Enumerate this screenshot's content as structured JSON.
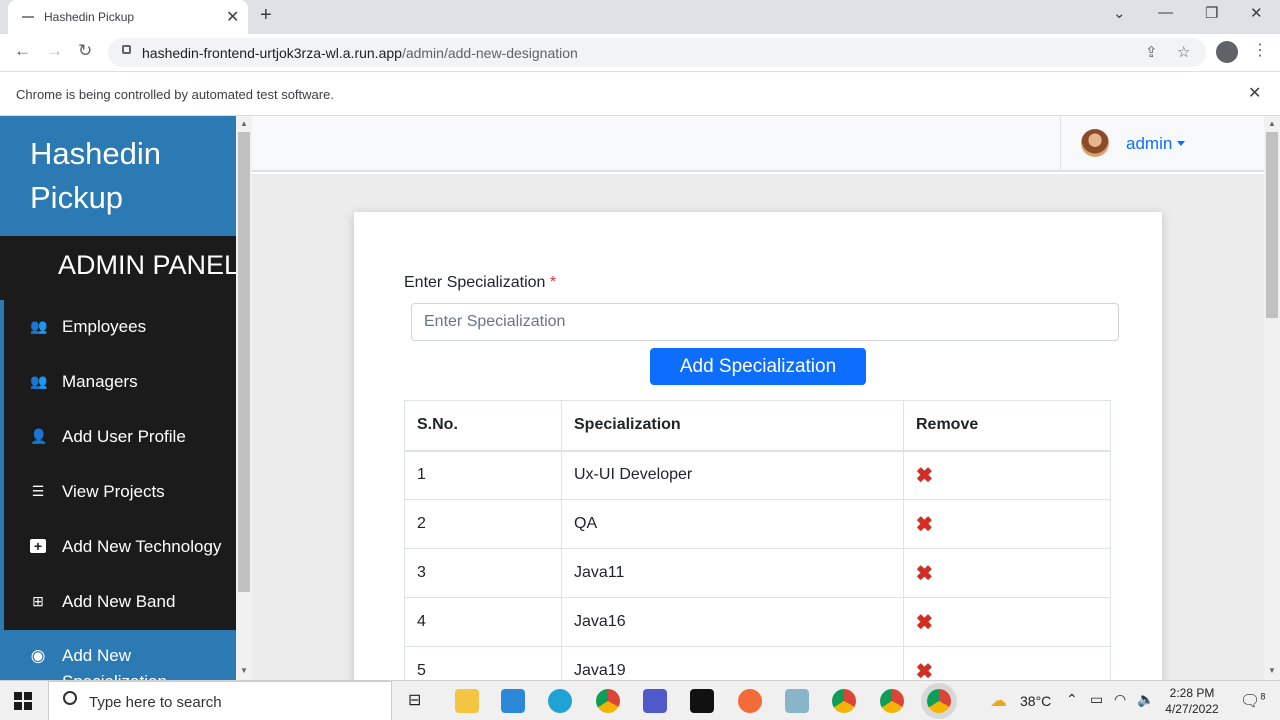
{
  "browser": {
    "tab_title": "Hashedin Pickup",
    "url_host": "hashedin-frontend-urtjok3rza-wl.a.run.app",
    "url_path": "/admin/add-new-designation",
    "infobar_text": "Chrome is being controlled by automated test software."
  },
  "sidebar": {
    "brand": "Hashedin Pickup",
    "panel_title": "ADMIN PANEL",
    "items": [
      {
        "label": "Employees",
        "icon": "users-icon"
      },
      {
        "label": "Managers",
        "icon": "users-icon"
      },
      {
        "label": "Add User Profile",
        "icon": "user-plus-icon"
      },
      {
        "label": "View Projects",
        "icon": "list-icon"
      },
      {
        "label": "Add New Technology",
        "icon": "plus-square-icon"
      },
      {
        "label": "Add New Band",
        "icon": "plus-square-outline-icon"
      },
      {
        "label": "Add New Specialization",
        "icon": "user-circle-icon"
      }
    ],
    "active_color": "#2c7ab3"
  },
  "topnav": {
    "user_label": "admin"
  },
  "form": {
    "label": "Enter Specialization",
    "required_mark": "*",
    "placeholder": "Enter Specialization",
    "value": "",
    "button_label": "Add Specialization",
    "button_color": "#0d6efd"
  },
  "table": {
    "headers": [
      "S.No.",
      "Specialization",
      "Remove"
    ],
    "rows": [
      {
        "sno": "1",
        "name": "Ux-UI Developer"
      },
      {
        "sno": "2",
        "name": "QA"
      },
      {
        "sno": "3",
        "name": "Java11"
      },
      {
        "sno": "4",
        "name": "Java16"
      },
      {
        "sno": "5",
        "name": "Java19"
      }
    ],
    "remove_icon": "red-x-icon"
  },
  "taskbar": {
    "search_placeholder": "Type here to search",
    "temperature": "38°C",
    "time": "2:28 PM",
    "date": "4/27/2022",
    "notification_count": "8"
  }
}
